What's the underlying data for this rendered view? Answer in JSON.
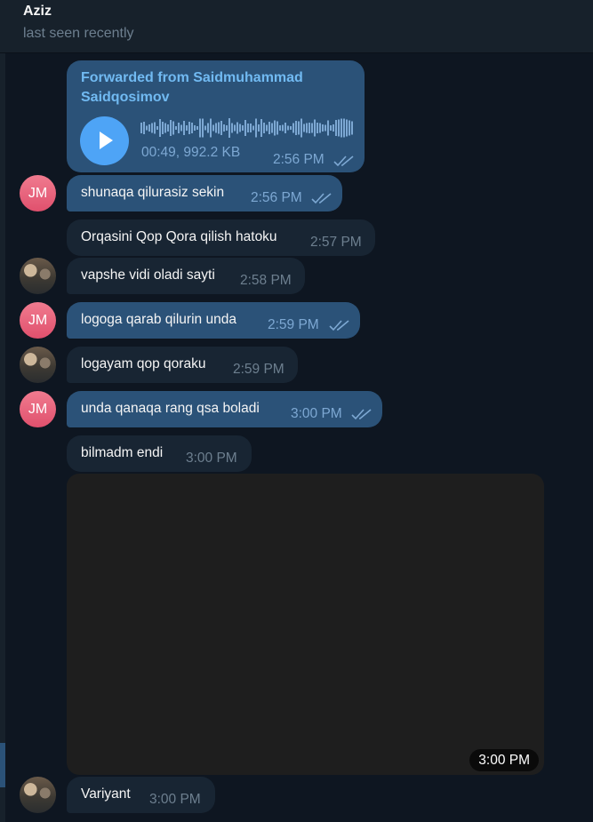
{
  "header": {
    "name": "Aziz",
    "status": "last seen recently"
  },
  "voice": {
    "forwarded": "Forwarded from Saidmuhammad Saidqosimov",
    "meta": "00:49, 992.2 KB",
    "time": "2:56 PM"
  },
  "messages": [
    {
      "text": "shunaqa qilurasiz sekin",
      "time": "2:56 PM"
    },
    {
      "text": "Orqasini Qop Qora qilish hatoku",
      "time": "2:57 PM"
    },
    {
      "text": "vapshe vidi oladi sayti",
      "time": "2:58 PM"
    },
    {
      "text": "logoga qarab qilurin unda",
      "time": "2:59 PM"
    },
    {
      "text": "logayam qop qoraku",
      "time": "2:59 PM"
    },
    {
      "text": "unda qanaqa rang qsa boladi",
      "time": "3:00 PM"
    },
    {
      "text": "bilmadm endi",
      "time": "3:00 PM"
    },
    {
      "text": "Variyant",
      "time": "3:00 PM"
    }
  ],
  "avatars": {
    "initials": "JM"
  },
  "media": {
    "time": "3:00 PM"
  },
  "colors": {
    "outgoing": "#2b5278",
    "incoming": "#182533",
    "background": "#0e1621",
    "accent": "#4ea4f6"
  }
}
